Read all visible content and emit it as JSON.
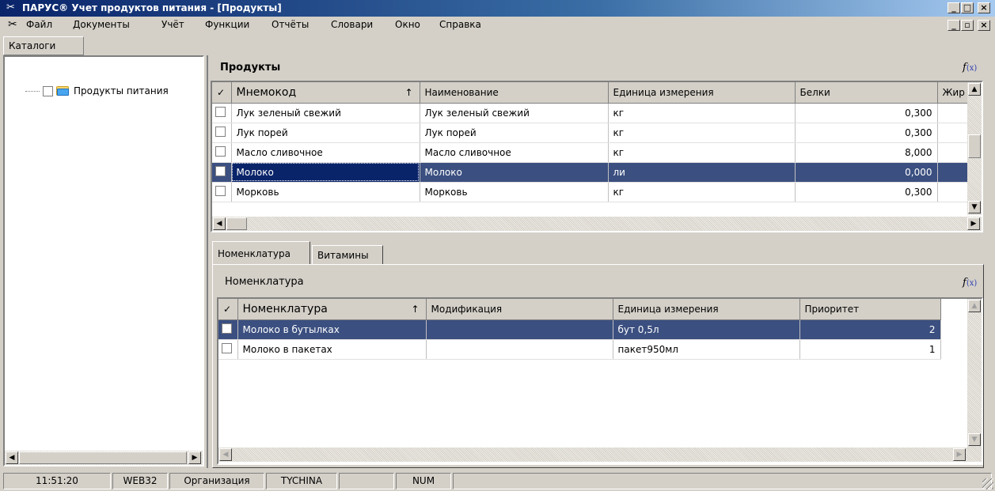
{
  "window": {
    "title": "ПАРУС® Учет продуктов питания - [Продукты]",
    "minimize": "_",
    "maximize": "□",
    "restore": "🗗",
    "close": "×"
  },
  "menu": {
    "items": [
      "Файл",
      "Документы",
      "Учёт",
      "Функции",
      "Отчёты",
      "Словари",
      "Окно",
      "Справка"
    ]
  },
  "left_panel": {
    "tab_label": "Каталоги",
    "tree": [
      {
        "label": "Продукты питания",
        "checked": false
      }
    ]
  },
  "products": {
    "header": "Продукты",
    "fx": "f(x)",
    "columns": [
      "Мнемокод",
      "Наименование",
      "Единица измерения",
      "Белки",
      "Жир"
    ],
    "rows": [
      {
        "mnemo": "Лук зеленый свежий",
        "name": "Лук зеленый свежий",
        "unit": "кг",
        "protein": "0,300",
        "selected": false
      },
      {
        "mnemo": "Лук порей",
        "name": "Лук порей",
        "unit": "кг",
        "protein": "0,300",
        "selected": false
      },
      {
        "mnemo": "Масло сливочное",
        "name": "Масло сливочное",
        "unit": "кг",
        "protein": "8,000",
        "selected": false
      },
      {
        "mnemo": "Молоко",
        "name": "Молоко",
        "unit": "ли",
        "protein": "0,000",
        "selected": true
      },
      {
        "mnemo": "Морковь",
        "name": "Морковь",
        "unit": "кг",
        "protein": "0,300",
        "selected": false
      }
    ]
  },
  "detail_tabs": [
    "Номенклатура",
    "Витамины"
  ],
  "nomenclature": {
    "header": "Номенклатура",
    "fx": "f(x)",
    "columns": [
      "Номенклатура",
      "Модификация",
      "Единица измерения",
      "Приоритет"
    ],
    "rows": [
      {
        "name": "Молоко в бутылках",
        "mod": "",
        "unit": "бут 0,5л",
        "priority": "2",
        "selected": true
      },
      {
        "name": "Молоко в пакетах",
        "mod": "",
        "unit": "пакет950мл",
        "priority": "1",
        "selected": false
      }
    ]
  },
  "statusbar": {
    "time": "11:51:20",
    "db": "WEB32",
    "org": "Организация",
    "user": "TYCHINA",
    "empty": "",
    "num": "NUM"
  }
}
